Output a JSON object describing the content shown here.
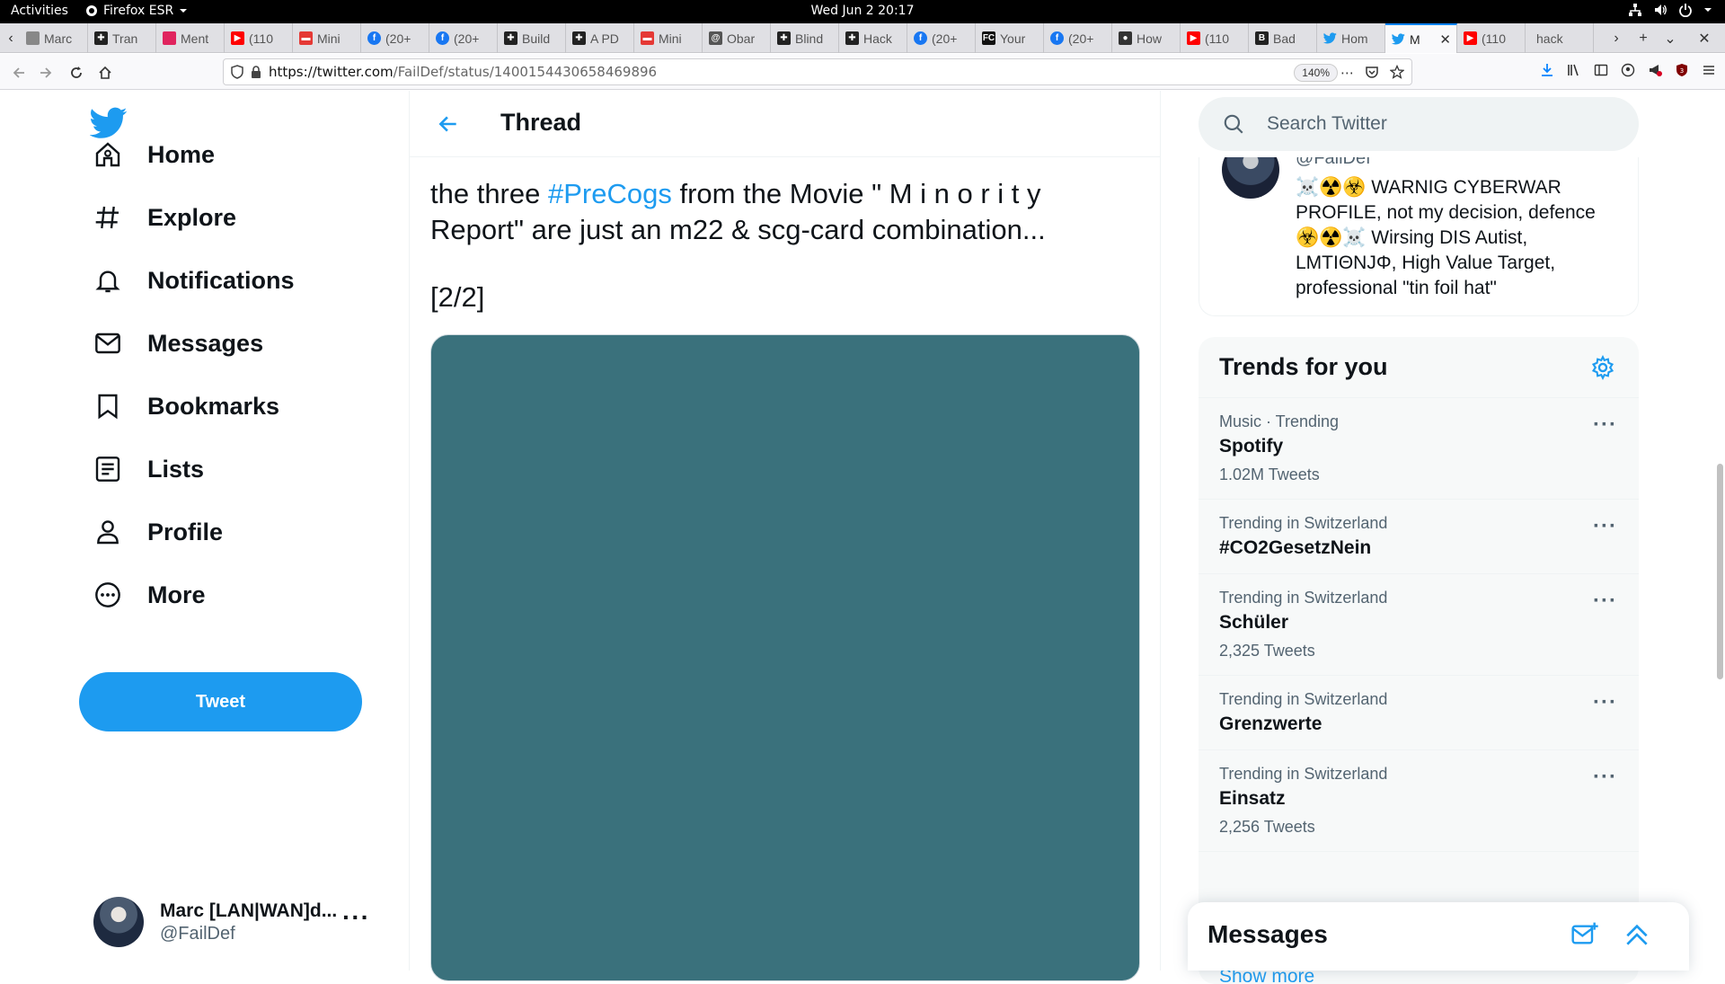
{
  "system": {
    "activities": "Activities",
    "app_name": "Firefox ESR",
    "clock": "Wed Jun 2  20:17"
  },
  "browser": {
    "tabs": [
      {
        "label": "Marc",
        "icon": "page-icon",
        "color": "#888888"
      },
      {
        "label": "Tran",
        "icon": "puzzle-icon",
        "color": "#222222"
      },
      {
        "label": "Ment",
        "icon": "page-icon",
        "color": "#e0245e"
      },
      {
        "label": "(110",
        "icon": "youtube-icon",
        "color": "#ff0000"
      },
      {
        "label": "Mini",
        "icon": "tube-icon",
        "color": "#e53935"
      },
      {
        "label": "(20+",
        "icon": "facebook-icon",
        "color": "#1877f2"
      },
      {
        "label": "(20+",
        "icon": "facebook-icon",
        "color": "#1877f2"
      },
      {
        "label": "Build",
        "icon": "puzzle-icon",
        "color": "#222222"
      },
      {
        "label": "A PD",
        "icon": "puzzle-icon",
        "color": "#222222"
      },
      {
        "label": "Mini",
        "icon": "tube-icon",
        "color": "#e53935"
      },
      {
        "label": "Obar",
        "icon": "at-icon",
        "color": "#555555"
      },
      {
        "label": "Blind",
        "icon": "puzzle-icon",
        "color": "#222222"
      },
      {
        "label": "Hack",
        "icon": "puzzle-icon",
        "color": "#222222"
      },
      {
        "label": "(20+",
        "icon": "facebook-icon",
        "color": "#1877f2"
      },
      {
        "label": "Your",
        "icon": "fc-icon",
        "color": "#111111"
      },
      {
        "label": "(20+",
        "icon": "facebook-icon",
        "color": "#1877f2"
      },
      {
        "label": "How",
        "icon": "circle-icon",
        "color": "#333333"
      },
      {
        "label": "(110",
        "icon": "youtube-icon",
        "color": "#ff0000"
      },
      {
        "label": "Bad",
        "icon": "b-icon",
        "color": "#222222"
      },
      {
        "label": "Hom",
        "icon": "twitter-icon",
        "color": "#1d9bf0"
      },
      {
        "label": "M",
        "icon": "twitter-icon",
        "color": "#1d9bf0",
        "active": true
      },
      {
        "label": "(110",
        "icon": "youtube-icon",
        "color": "#ff0000"
      },
      {
        "label": "hack",
        "icon": "none",
        "color": "#ffffff"
      }
    ],
    "url_host": "https://twitter.com",
    "url_path": "/FailDef/status/1400154430658469896",
    "zoom": "140%",
    "notification_badge": "3"
  },
  "twitter": {
    "nav": [
      {
        "label": "Home",
        "icon": "home-icon"
      },
      {
        "label": "Explore",
        "icon": "hashtag-icon"
      },
      {
        "label": "Notifications",
        "icon": "bell-icon"
      },
      {
        "label": "Messages",
        "icon": "mail-icon"
      },
      {
        "label": "Bookmarks",
        "icon": "bookmark-icon"
      },
      {
        "label": "Lists",
        "icon": "list-icon"
      },
      {
        "label": "Profile",
        "icon": "person-icon"
      },
      {
        "label": "More",
        "icon": "more-circle-icon"
      }
    ],
    "tweet_button": "Tweet",
    "account": {
      "name": "Marc [LAN|WAN]d...",
      "handle": "@FailDef"
    },
    "thread": {
      "title": "Thread",
      "text_before": "the three ",
      "hashtag": "#PreCogs",
      "text_after": " from the Movie \" M i n o r i t y Report\" are just an m22 & scg-card combination...",
      "part": "[2/2]",
      "media_color": "#3a717c"
    },
    "search_placeholder": "Search Twitter",
    "profile_card": {
      "handle": "@FailDef",
      "bio": "☠️☢️☣️ WARNIG CYBERWAR PROFILE, not my decision, defence ☣️☢️☠️ Wirsing DIS Autist, LMTIΘNJΦ, High Value Target, professional \"tin foil hat\""
    },
    "trends": {
      "title": "Trends for you",
      "items": [
        {
          "context": "Music · Trending",
          "name": "Spotify",
          "count": "1.02M Tweets"
        },
        {
          "context": "Trending in Switzerland",
          "name": "#CO2GesetzNein",
          "count": ""
        },
        {
          "context": "Trending in Switzerland",
          "name": "Schüler",
          "count": "2,325 Tweets"
        },
        {
          "context": "Trending in Switzerland",
          "name": "Grenzwerte",
          "count": ""
        },
        {
          "context": "Trending in Switzerland",
          "name": "Einsatz",
          "count": "2,256 Tweets"
        }
      ],
      "show_more": "Show more"
    },
    "messages_dock": "Messages",
    "accent": "#1d9bf0"
  }
}
